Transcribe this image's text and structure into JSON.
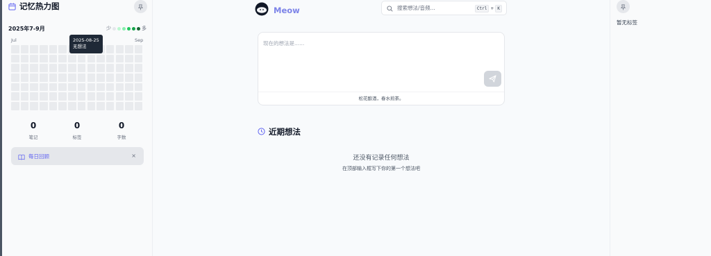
{
  "heatmap": {
    "title": "记忆热力图",
    "range": "2025年7-9月",
    "legend_less": "少",
    "legend_more": "多",
    "legend_colors": [
      "#e5e7eb",
      "#bbf7d0",
      "#86efac",
      "#22c55e",
      "#16a34a",
      "#166534"
    ],
    "month_start": "Jul",
    "month_end": "Sep",
    "tooltip_date": "2025-08-25",
    "tooltip_text": "无想法"
  },
  "stats": [
    {
      "value": "0",
      "label": "笔记"
    },
    {
      "value": "0",
      "label": "标签"
    },
    {
      "value": "0",
      "label": "字数"
    }
  ],
  "review": {
    "label": "每日回顾",
    "close": "×"
  },
  "header": {
    "brand": "Meow",
    "search_placeholder": "搜索想法/音频...",
    "shortcut_key1": "Ctrl",
    "shortcut_plus": "+",
    "shortcut_key2": "K"
  },
  "composer": {
    "placeholder": "现在的想法是......",
    "footer": "松花酿酒，春水煎茶。"
  },
  "recent": {
    "title": "近期想法",
    "empty_title": "还没有记录任何想法",
    "empty_hint": "在顶部输入框写下你的第一个想法吧"
  },
  "tags": {
    "empty": "暂无标签"
  },
  "colors": {
    "accent": "#7c83e8",
    "edge": "#4b5563"
  }
}
